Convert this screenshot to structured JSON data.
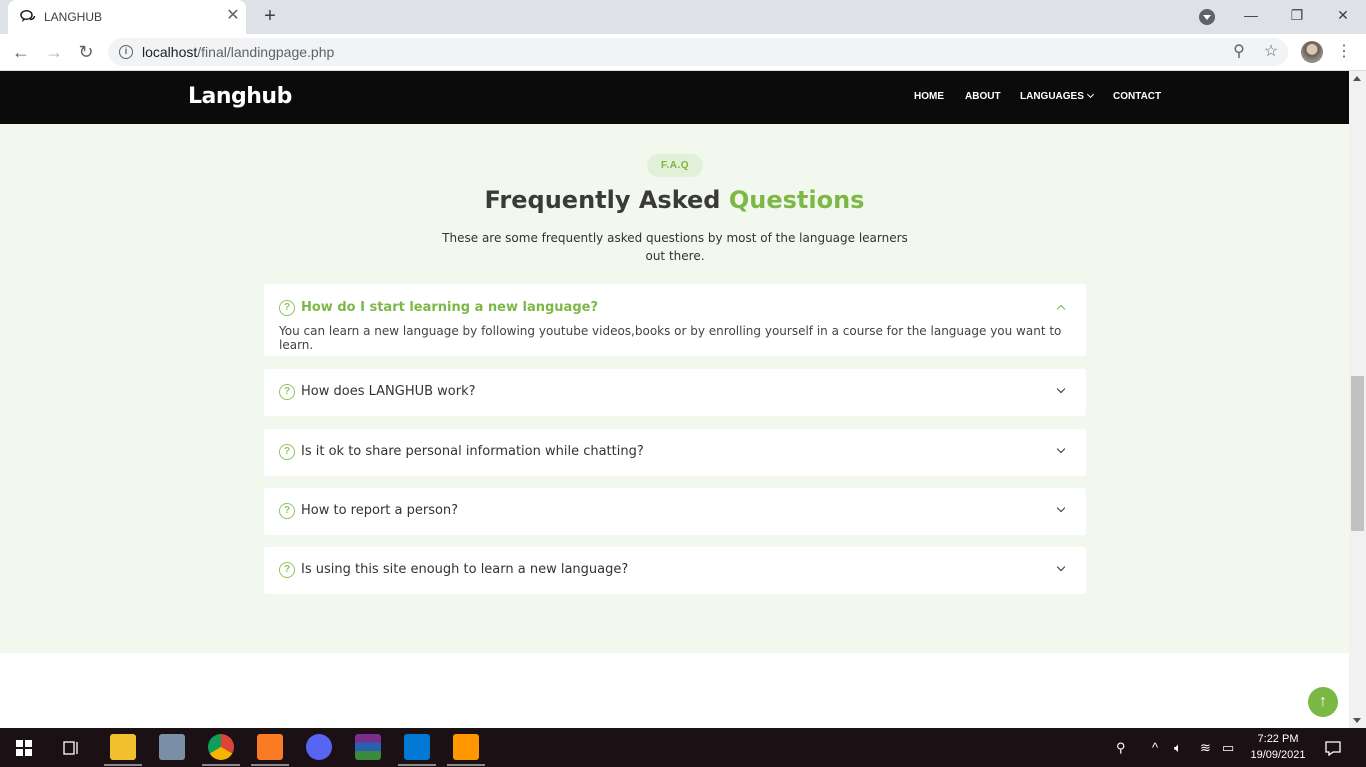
{
  "browser": {
    "tab_title": "LANGHUB",
    "url_host": "localhost",
    "url_path": "/final/landingpage.php"
  },
  "site": {
    "logo": "Langhub",
    "nav": [
      "HOME",
      "ABOUT",
      "LANGUAGES",
      "CONTACT"
    ]
  },
  "faq": {
    "badge": "F.A.Q",
    "title_main": "Frequently Asked",
    "title_accent": "Questions",
    "subtitle": "These are some frequently asked questions by most of the language learners out there.",
    "items": [
      {
        "question": "How do I start learning a new language?",
        "answer": "You can learn a new language by following youtube videos,books or by enrolling yourself in a course for the language you want to learn.",
        "expanded": true
      },
      {
        "question": "How does LANGHUB work?",
        "expanded": false
      },
      {
        "question": "Is it ok to share personal information while chatting?",
        "expanded": false
      },
      {
        "question": "How to report a person?",
        "expanded": false
      },
      {
        "question": "Is using this site enough to learn a new language?",
        "expanded": false
      }
    ]
  },
  "taskbar": {
    "time": "7:22 PM",
    "date": "19/09/2021"
  },
  "colors": {
    "accent": "#7cb846",
    "section_bg": "#f2f8ed",
    "header_bg": "#0b0b0b"
  }
}
